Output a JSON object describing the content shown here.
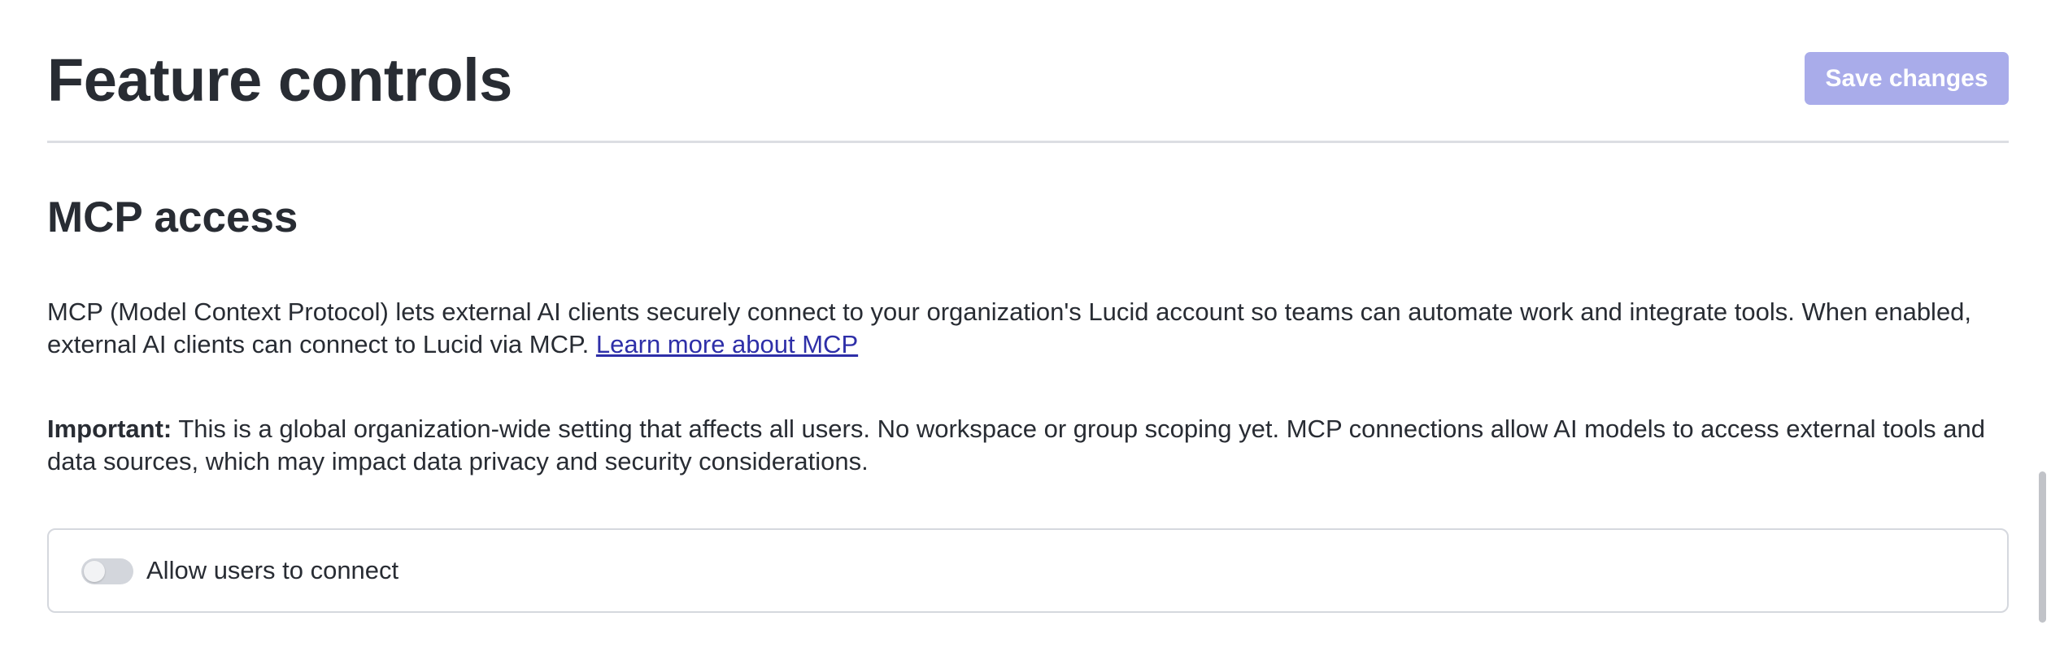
{
  "header": {
    "title": "Feature controls",
    "save_label": "Save changes"
  },
  "section": {
    "title": "MCP access",
    "description": "MCP (Model Context Protocol) lets external AI clients securely connect to your organization's Lucid account so teams can automate work and integrate tools. When enabled, external AI clients can connect to Lucid via MCP. ",
    "link_text": "Learn more about MCP",
    "important_label": "Important:",
    "important_text": " This is a global organization-wide setting that affects all users. No workspace or group scoping yet. MCP connections allow AI models to access external tools and data sources, which may impact data privacy and security considerations."
  },
  "toggle": {
    "label": "Allow users to connect",
    "enabled": false
  },
  "colors": {
    "primary_disabled": "#a9acea",
    "link": "#2e2fa8",
    "text": "#282c33",
    "toggle_off": "#d3d6dc"
  }
}
